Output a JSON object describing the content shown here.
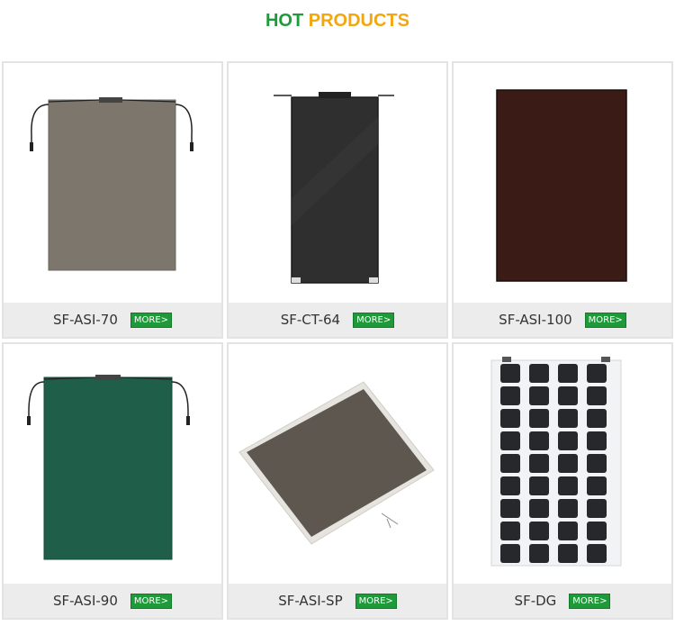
{
  "heading": {
    "part1": "HOT",
    "part2": "PRODUCTS"
  },
  "more_label": "MORE>",
  "products": [
    {
      "name": "SF-ASI-70"
    },
    {
      "name": "SF-CT-64"
    },
    {
      "name": "SF-ASI-100"
    },
    {
      "name": "SF-ASI-90"
    },
    {
      "name": "SF-ASI-SP"
    },
    {
      "name": "SF-DG"
    }
  ],
  "colors": {
    "hot": "#1f9a3a",
    "products": "#f2a60f",
    "more_button": "#1f9a3a",
    "card_footer": "#ececec"
  }
}
